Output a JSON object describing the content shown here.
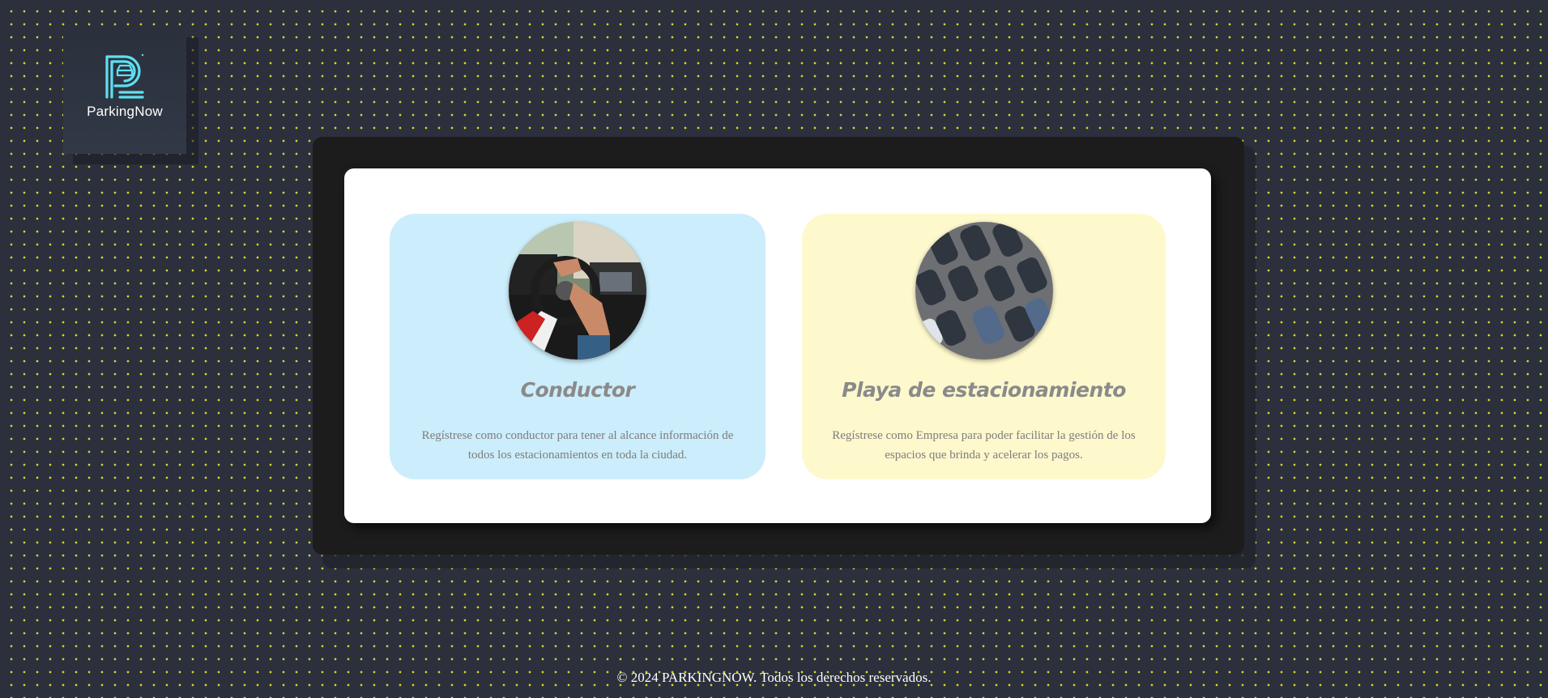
{
  "brand": {
    "name": "ParkingNow",
    "icon": "parking-p-logo-icon",
    "accent_color": "#5ee0f0"
  },
  "options": [
    {
      "title": "Conductor",
      "description": "Regístrese como conductor para tener al alcance información de todos los estacionamientos en toda la ciudad.",
      "image": "driver-steering-wheel-photo",
      "color": "#ccedfb"
    },
    {
      "title": "Playa de estacionamiento",
      "description": "Regístrese como Empresa para poder facilitar la gestión de los espacios que brinda y acelerar los pagos.",
      "image": "parking-lot-cars-photo",
      "color": "#fef8cd"
    }
  ],
  "footer": {
    "text": "© 2024 PARKINGNOW. Todos los derechos reservados."
  }
}
